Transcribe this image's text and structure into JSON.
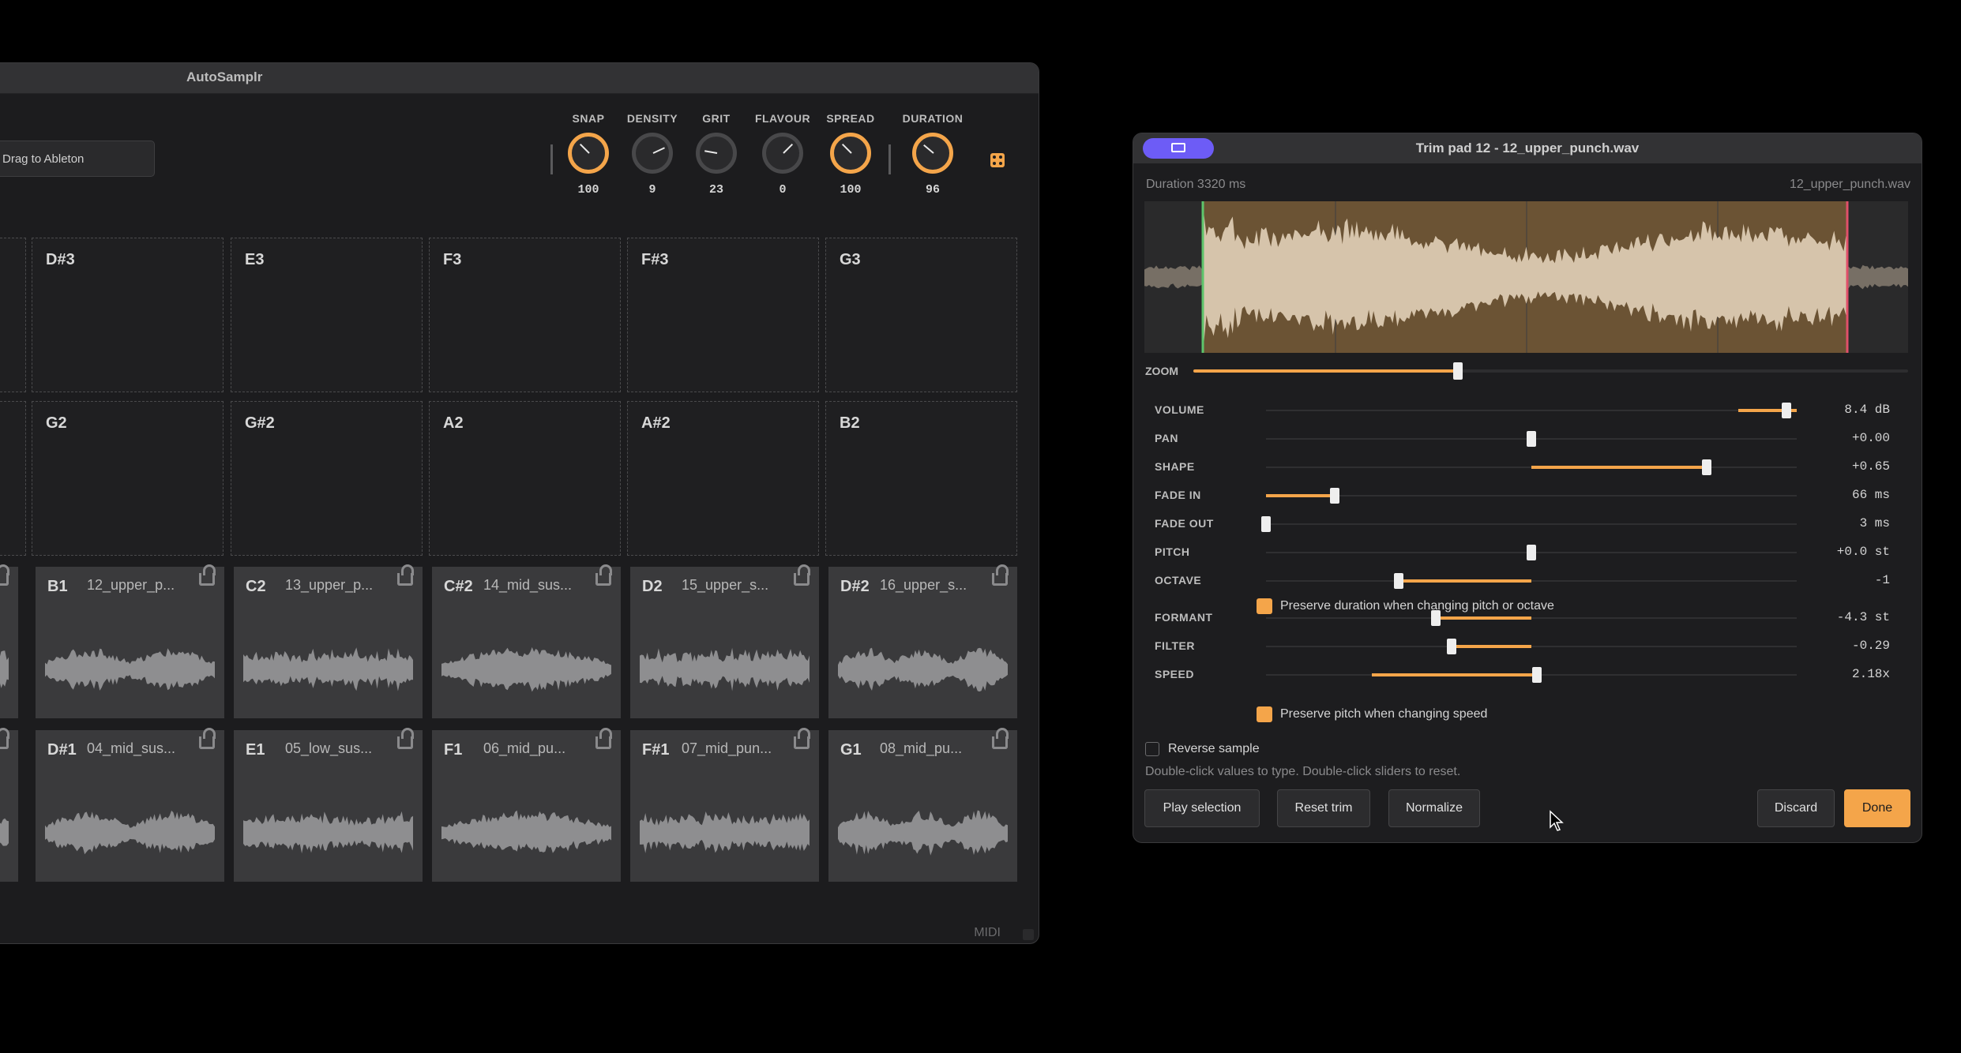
{
  "main": {
    "title": "AutoSamplr",
    "drag_label": "Drag to Ableton",
    "midi_label": "MIDI",
    "knobs": [
      {
        "label": "SNAP",
        "value": "100",
        "style": "orange"
      },
      {
        "label": "DENSITY",
        "value": "9",
        "style": "grey"
      },
      {
        "label": "GRIT",
        "value": "23",
        "style": "grey"
      },
      {
        "label": "FLAVOUR",
        "value": "0",
        "style": "grey"
      },
      {
        "label": "SPREAD",
        "value": "100",
        "style": "orange"
      },
      {
        "label": "DURATION",
        "value": "96",
        "style": "orange"
      }
    ],
    "pads_row1": [
      "D#3",
      "E3",
      "F3",
      "F#3",
      "G3"
    ],
    "pads_row2": [
      "G2",
      "G#2",
      "A2",
      "A#2",
      "B2"
    ],
    "pads_row3": [
      {
        "note": "B1",
        "file": "12_upper_p..."
      },
      {
        "note": "C2",
        "file": "13_upper_p..."
      },
      {
        "note": "C#2",
        "file": "14_mid_sus..."
      },
      {
        "note": "D2",
        "file": "15_upper_s..."
      },
      {
        "note": "D#2",
        "file": "16_upper_s..."
      }
    ],
    "pads_row4": [
      {
        "note": "D#1",
        "file": "04_mid_sus..."
      },
      {
        "note": "E1",
        "file": "05_low_sus..."
      },
      {
        "note": "F1",
        "file": "06_mid_pu..."
      },
      {
        "note": "F#1",
        "file": "07_mid_pun..."
      },
      {
        "note": "G1",
        "file": "08_mid_pu..."
      }
    ]
  },
  "trim": {
    "title": "Trim pad 12 - 12_upper_punch.wav",
    "duration": "Duration 3320 ms",
    "file": "12_upper_punch.wav",
    "zoom_label": "ZOOM",
    "zoom_level": 0.37,
    "params": [
      {
        "label": "VOLUME",
        "value": "8.4 dB"
      },
      {
        "label": "PAN",
        "value": "+0.00"
      },
      {
        "label": "SHAPE",
        "value": "+0.65"
      },
      {
        "label": "FADE IN",
        "value": "66 ms"
      },
      {
        "label": "FADE OUT",
        "value": "3 ms"
      },
      {
        "label": "PITCH",
        "value": "+0.0 st"
      },
      {
        "label": "OCTAVE",
        "value": "-1"
      },
      {
        "label": "FORMANT",
        "value": "-4.3 st"
      },
      {
        "label": "FILTER",
        "value": "-0.29"
      },
      {
        "label": "SPEED",
        "value": "2.18x"
      }
    ],
    "preserve_duration": "Preserve duration when changing pitch or octave",
    "preserve_pitch": "Preserve pitch when changing speed",
    "reverse": "Reverse sample",
    "hint": "Double-click values to type. Double-click sliders to reset.",
    "buttons": {
      "play": "Play selection",
      "reset": "Reset trim",
      "normalize": "Normalize",
      "discard": "Discard",
      "done": "Done"
    }
  },
  "colors": {
    "accent": "#f4a54a",
    "monitor": "#6d5cf6",
    "start_marker": "#5ec46b",
    "end_marker": "#e0506a"
  }
}
